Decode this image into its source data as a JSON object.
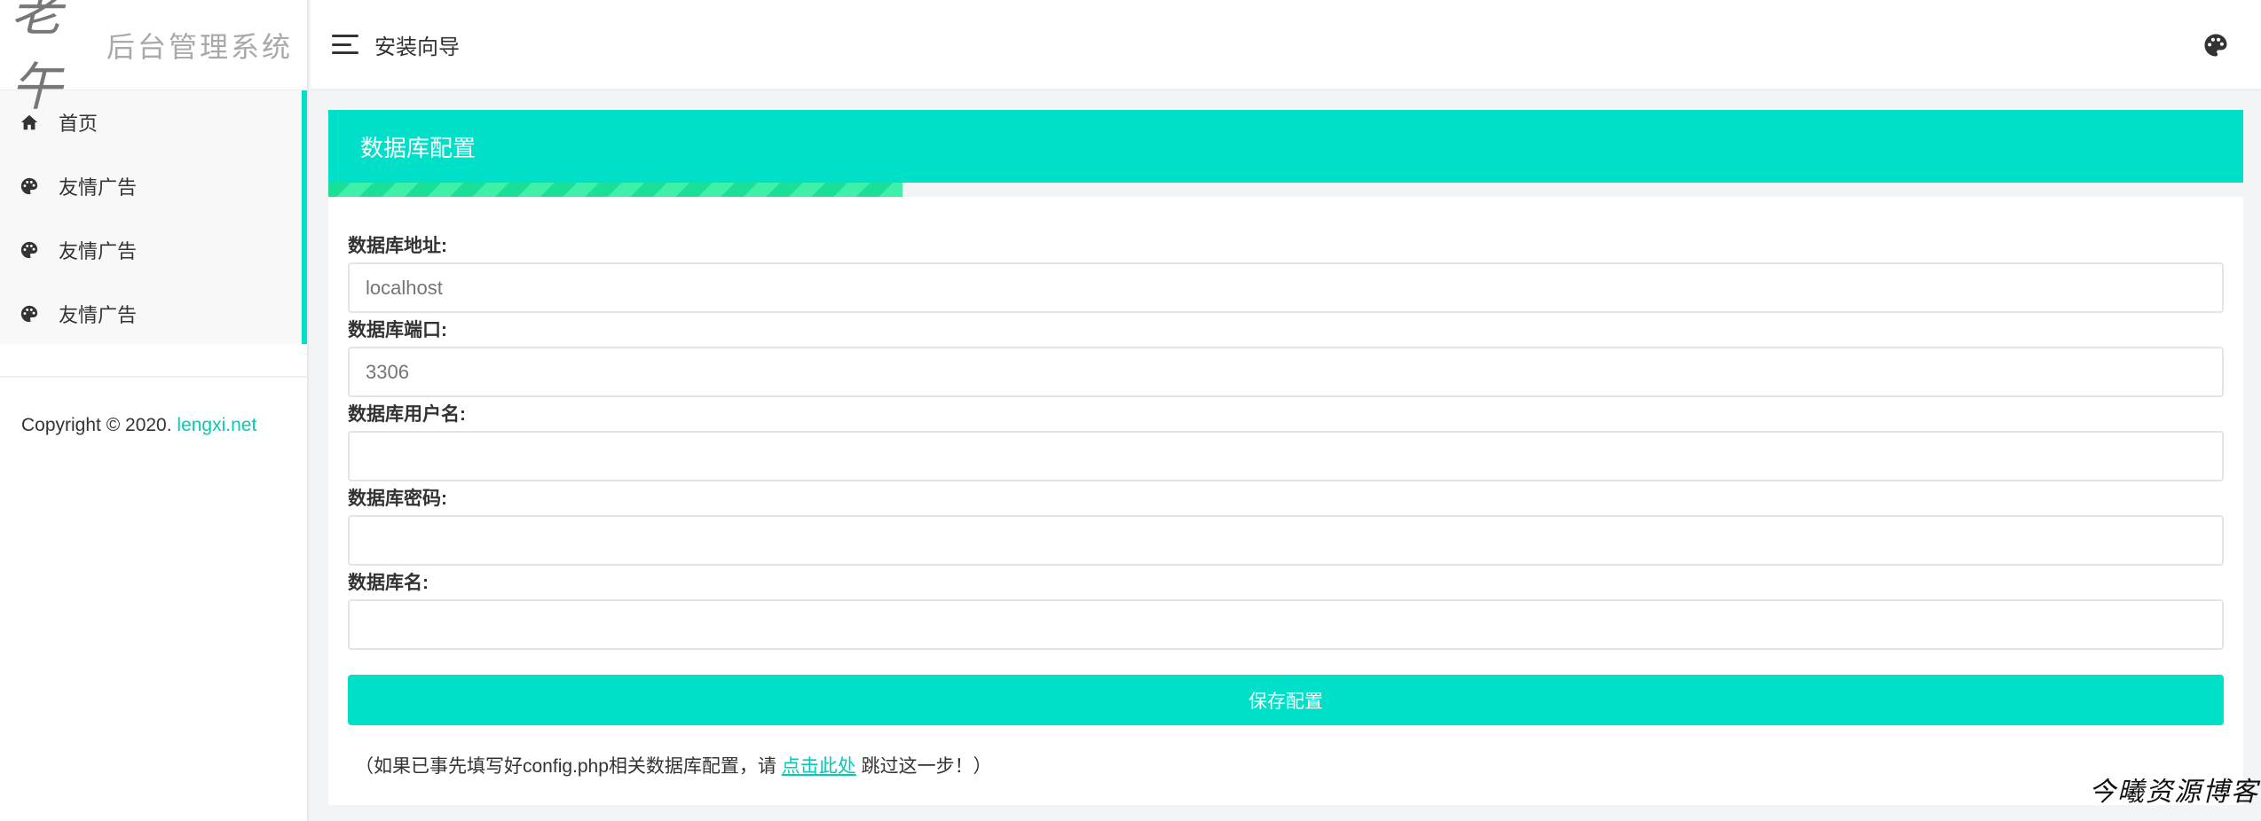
{
  "brand": {
    "mark": "老午",
    "title": "后台管理系统"
  },
  "sidebar": {
    "items": [
      {
        "label": "首页",
        "icon": "home-icon"
      },
      {
        "label": "友情广告",
        "icon": "palette-icon"
      },
      {
        "label": "友情广告",
        "icon": "palette-icon"
      },
      {
        "label": "友情广告",
        "icon": "palette-icon"
      }
    ],
    "copyright_prefix": "Copyright © 2020. ",
    "copyright_link": "lengxi.net"
  },
  "header": {
    "title": "安装向导",
    "theme_icon": "palette-icon"
  },
  "card": {
    "title": "数据库配置",
    "progress": 0.3
  },
  "form": {
    "host": {
      "label": "数据库地址:",
      "placeholder": "localhost"
    },
    "port": {
      "label": "数据库端口:",
      "placeholder": "3306"
    },
    "user": {
      "label": "数据库用户名:",
      "placeholder": ""
    },
    "password": {
      "label": "数据库密码:",
      "placeholder": ""
    },
    "dbname": {
      "label": "数据库名:",
      "placeholder": ""
    },
    "save_label": "保存配置",
    "hint_prefix": "（如果已事先填写好config.php相关数据库配置，请 ",
    "hint_link": "点击此处",
    "hint_suffix": " 跳过这一步！）"
  },
  "watermark": "今曦资源博客",
  "colors": {
    "accent": "#00e0c8",
    "progress": "#19e096",
    "link": "#00cdb6"
  }
}
